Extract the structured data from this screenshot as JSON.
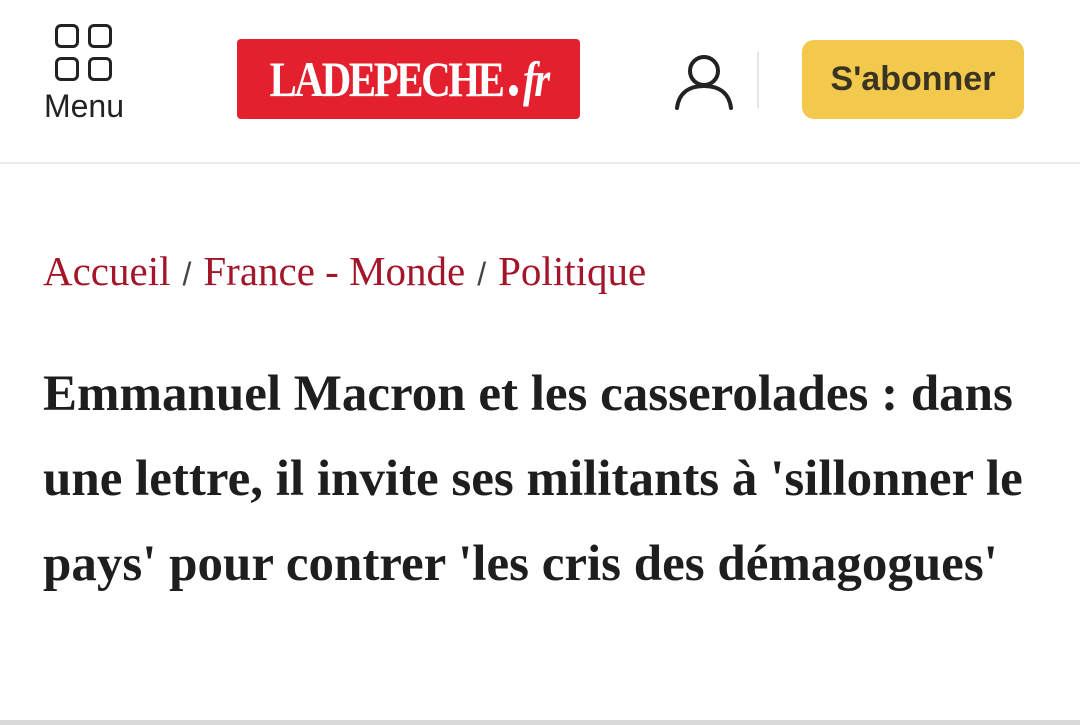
{
  "header": {
    "menu_label": "Menu",
    "logo": {
      "name": "LADEPECHE",
      "suffix": "fr",
      "background": "#e5202e"
    },
    "user_icon": "user-icon",
    "subscribe_label": "S'abonner",
    "subscribe_color": "#f2c94c"
  },
  "breadcrumb": {
    "items": [
      "Accueil",
      "France - Monde",
      "Politique"
    ],
    "separator": "/",
    "link_color": "#a3162a"
  },
  "article": {
    "title": "Emmanuel Macron et les casserolades : dans une lettre, il invite ses militants à 'sillonner le pays' pour contrer 'les cris des démagogues'"
  }
}
